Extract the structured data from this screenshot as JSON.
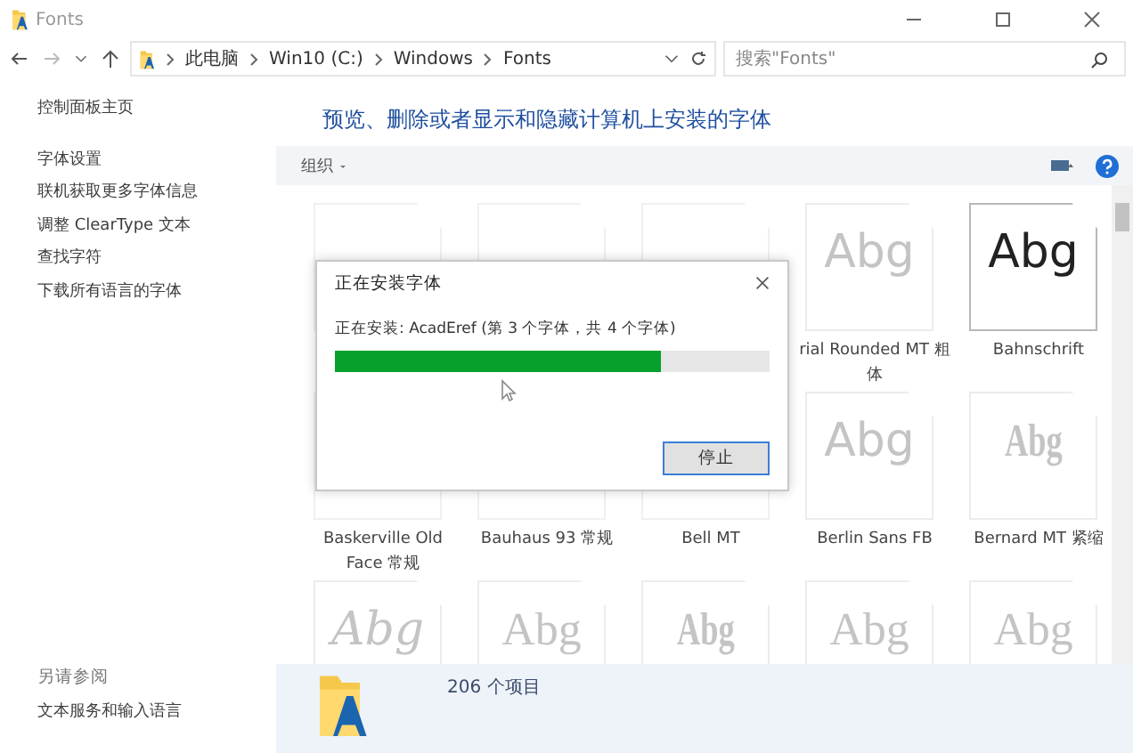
{
  "window": {
    "title": "Fonts"
  },
  "address": {
    "crumbs": [
      "此电脑",
      "Win10 (C:)",
      "Windows",
      "Fonts"
    ],
    "search_placeholder": "搜索\"Fonts\""
  },
  "sidebar": {
    "home": "控制面板主页",
    "links": [
      "字体设置",
      "联机获取更多字体信息",
      "调整 ClearType 文本",
      "查找字符",
      "下载所有语言的字体"
    ],
    "see_also_title": "另请参阅",
    "see_also": [
      "文本服务和输入语言"
    ]
  },
  "heading": "预览、删除或者显示和隐藏计算机上安装的字体",
  "toolbar": {
    "organize": "组织"
  },
  "tiles": [
    {
      "kind": "blank"
    },
    {
      "kind": "blank"
    },
    {
      "kind": "blank"
    },
    {
      "kind": "sans",
      "sample": "Abg",
      "label": "rial Rounded MT 粗体"
    },
    {
      "kind": "dark-sans",
      "sample": "Abg",
      "label": "Bahnschrift"
    },
    {
      "kind": "blank",
      "label": "Baskerville Old Face 常规"
    },
    {
      "kind": "blank",
      "label": "Bauhaus 93 常规"
    },
    {
      "kind": "blank",
      "label": "Bell MT"
    },
    {
      "kind": "sans",
      "sample": "Abg",
      "label": "Berlin Sans FB"
    },
    {
      "kind": "condensed",
      "sample": "Abg",
      "label": "Bernard MT 紧缩"
    },
    {
      "kind": "script",
      "sample": "Abg"
    },
    {
      "kind": "serif",
      "sample": "Abg"
    },
    {
      "kind": "condensed",
      "sample": "Abg"
    },
    {
      "kind": "serif",
      "sample": "Abg"
    },
    {
      "kind": "serif",
      "sample": "Abg"
    }
  ],
  "details": {
    "count": "206 个项目"
  },
  "dialog": {
    "title": "正在安装字体",
    "status": "正在安装: AcadEref (第 3 个字体，共 4 个字体)",
    "level": 0.75,
    "button": "停止"
  }
}
